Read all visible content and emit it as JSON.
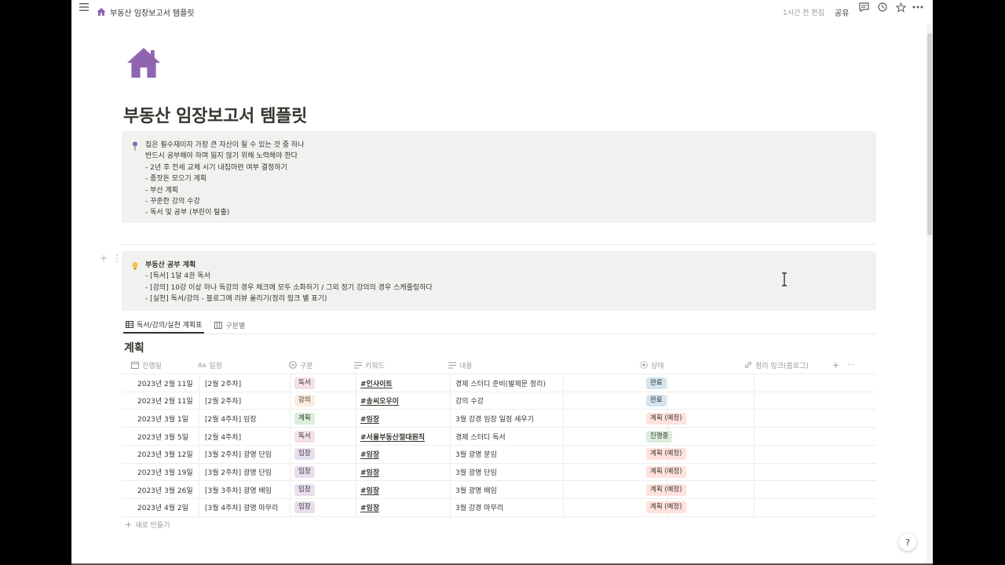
{
  "topbar": {
    "breadcrumb": "부동산 임장보고서 템플릿",
    "edited": "1시간 전 편집",
    "share_label": "공유"
  },
  "page": {
    "icon": "house-icon",
    "title": "부동산 임장보고서 템플릿"
  },
  "callout1": {
    "icon": "pushpin-icon",
    "lines": [
      "집은 필수재이자 가장 큰 자산이 될 수 있는 것 중 하나",
      "반드시 공부해야 하며 잃지 않기 위해 노력해야 한다",
      "- 2년 후 전세 교체 시기 내집마련 여부 결정하기",
      "- 종잣돈 모으기 계획",
      "- 부산 계획",
      "- 꾸준한 강의 수강",
      "- 독서 및 공부 (부린이 탈출)"
    ]
  },
  "callout2": {
    "icon": "lightbulb-icon",
    "title": "부동산 공부 계획",
    "lines": [
      "- [독서] 1달 4권 독서",
      "- [강의] 10강 이상 하나 독강의 경우 체크에 모두 소화하기 / 그외 정기 강의의 경우 스케줄링하다",
      "- [실천] 독서/강의 - 블로그에 리뷰 올리기(정리 링크 별 표기)"
    ]
  },
  "views": {
    "tabs": [
      {
        "label": "독서/강의/실천 계획표",
        "icon": "table-icon",
        "active": true
      },
      {
        "label": "구분별",
        "icon": "board-icon",
        "active": false
      }
    ]
  },
  "database": {
    "title": "계획",
    "columns": [
      {
        "label": "진행일",
        "icon": "calendar-icon"
      },
      {
        "label": "일정",
        "icon": "text-icon"
      },
      {
        "label": "구분",
        "icon": "select-icon"
      },
      {
        "label": "키워드",
        "icon": "lines-icon"
      },
      {
        "label": "내용",
        "icon": "lines-icon"
      },
      {
        "label": "상태",
        "icon": "status-icon"
      },
      {
        "label": "정리 링크(블로그)",
        "icon": "link-icon"
      }
    ],
    "rows": [
      {
        "date": "2023년 2월 11일",
        "schedule": "[2월 2주차]",
        "category": "독서",
        "keyword": "#인사이트",
        "content": "경제 스터디 준비(발제문 정리)",
        "status": "완료"
      },
      {
        "date": "2023년 2월 11일",
        "schedule": "[2월 2주차]",
        "category": "강의",
        "keyword": "#송씨오우이",
        "content": "강의 수강",
        "status": "완료"
      },
      {
        "date": "2023년 3월 1일",
        "schedule": "[2월 4주차] 임장",
        "category": "계획",
        "keyword": "#임장",
        "content": "3월 강경 임장 일정 세우기",
        "status": "계획 (예정)"
      },
      {
        "date": "2023년 3월 5일",
        "schedule": "[2월 4주차]",
        "category": "독서",
        "keyword": "#서울부동산절대원칙",
        "content": "경제 스터디 독서",
        "status": "진행중"
      },
      {
        "date": "2023년 3월 12일",
        "schedule": "[3월 2주차] 광명 단임",
        "category": "임장",
        "keyword": "#임장",
        "content": "3월 광명 분임",
        "status": "계획 (예정)"
      },
      {
        "date": "2023년 3월 19일",
        "schedule": "[3월 2주차] 광명 단임",
        "category": "임장",
        "keyword": "#임장",
        "content": "3월 광명 단임",
        "status": "계획 (예정)"
      },
      {
        "date": "2023년 3월 26일",
        "schedule": "[3월 3주차] 광명 배임",
        "category": "임장",
        "keyword": "#임장",
        "content": "3월 광명 배임",
        "status": "계획 (예정)"
      },
      {
        "date": "2023년 4월 2일",
        "schedule": "[3월 4주차] 광명 마무리",
        "category": "임장",
        "keyword": "#임장",
        "content": "3월 강경 마무리",
        "status": "계획 (예정)"
      }
    ],
    "new_label": "새로 만들기",
    "add_col_icon": "plus-icon",
    "more_icon": "ellipsis-icon"
  },
  "colors": {
    "accent_purple": "#9065b0",
    "tag_독서": "#f4dfeb",
    "tag_강의": "#fbecdd",
    "tag_계획": "#dbeddb",
    "tag_임장": "#e8deee",
    "status_완료": "#d3e5ef",
    "status_진행중": "#dbeddb",
    "status_계획": "#ffe2dd"
  },
  "help_label": "?"
}
